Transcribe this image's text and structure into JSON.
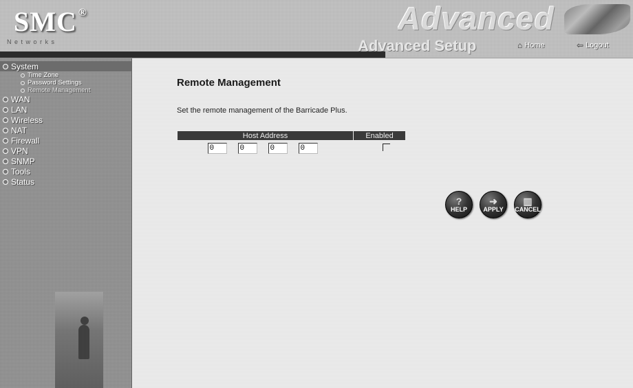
{
  "header": {
    "logo": "SMC",
    "logo_mark": "®",
    "tagline": "N e t w o r k s",
    "brand_big": "Advanced",
    "brand_sub": "Advanced Setup",
    "home_label": "Home",
    "home_icon": "home-icon",
    "logout_label": "Logout",
    "logout_icon": "logout-icon"
  },
  "sidebar": {
    "items": [
      {
        "label": "System",
        "active": true
      },
      {
        "label": "WAN"
      },
      {
        "label": "LAN"
      },
      {
        "label": "Wireless"
      },
      {
        "label": "NAT"
      },
      {
        "label": "Firewall"
      },
      {
        "label": "VPN"
      },
      {
        "label": "SNMP"
      },
      {
        "label": "Tools"
      },
      {
        "label": "Status"
      }
    ],
    "system_sub": [
      {
        "label": "Time Zone"
      },
      {
        "label": "Password Settings"
      },
      {
        "label": "Remote Management"
      }
    ]
  },
  "main": {
    "title": "Remote Management",
    "description": "Set the remote management of the Barricade Plus.",
    "table": {
      "col_host": "Host Address",
      "col_enabled": "Enabled",
      "ip": [
        "0",
        "0",
        "0",
        "0"
      ],
      "enabled": false
    },
    "buttons": {
      "help": "HELP",
      "apply": "APPLY",
      "cancel": "CANCEL"
    }
  },
  "colors": {
    "sidebar_bg": "#8f8f8f",
    "header_bg": "#bdbdbd",
    "table_header_bg": "#3a3a3a",
    "page_bg": "#ececec"
  }
}
